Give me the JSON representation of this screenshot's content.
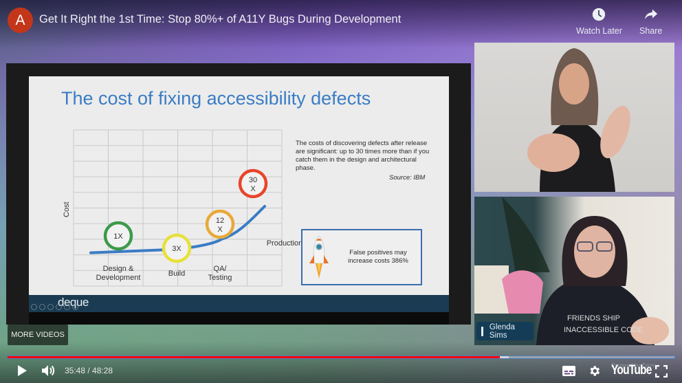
{
  "header": {
    "channel_avatar_letter": "A",
    "title": "Get It Right the 1st Time: Stop 80%+ of A11Y Bugs During Development",
    "actions": [
      {
        "label": "Watch Later",
        "icon": "clock-icon"
      },
      {
        "label": "Share",
        "icon": "share-arrow-icon"
      }
    ]
  },
  "slide": {
    "title": "The cost of fixing accessibility defects",
    "info_text": "The costs of discovering defects after release are significant: up to 30 times more than if you catch them in the design and architectural phase.",
    "source": "Source: IBM",
    "callout_text": "False positives may increase costs 386%",
    "callout_icon": "rocket-icon",
    "footer_logo": "deque",
    "colors": {
      "title": "#3a7cc4",
      "curve": "#3a7cc4",
      "footer": "#1a3b52"
    }
  },
  "chart_data": {
    "type": "line",
    "title": "",
    "xlabel": "",
    "ylabel": "Cost",
    "grid": true,
    "stages": [
      {
        "label": "Design & Development",
        "multiplier": "1X",
        "color": "#3d9a4a"
      },
      {
        "label": "Build",
        "multiplier": "3X",
        "color": "#e8e03a"
      },
      {
        "label": "QA/ Testing",
        "multiplier": "12 X",
        "color": "#e8a93a"
      },
      {
        "label": "Production",
        "multiplier": "30 X",
        "color": "#e8452a"
      }
    ],
    "values": [
      1,
      3,
      12,
      30
    ]
  },
  "webcams": [
    {
      "name_tag": ""
    },
    {
      "name_tag": "Glenda Sims"
    }
  ],
  "more_videos_label": "MORE VIDEOS",
  "player": {
    "current_time": "35:48",
    "duration": "48:28",
    "time_display": "35:48 / 48:28",
    "progress_fraction": 0.738,
    "buffered_fraction": 0.752,
    "powered_by": "Powered by Zoom",
    "logo": "YouTube",
    "colors": {
      "played": "#ff0000",
      "track_border": "#4a7cc4"
    }
  }
}
